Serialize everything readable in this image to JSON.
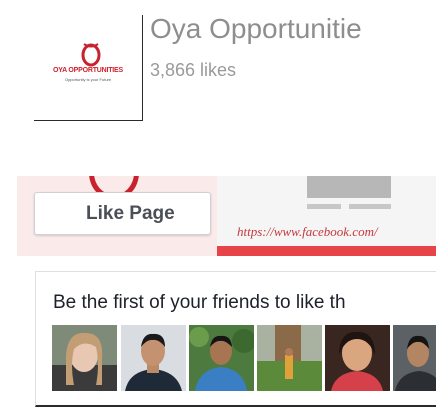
{
  "page": {
    "name": "Oya Opportunitie",
    "likes": "3,866 likes",
    "logo": {
      "title": "OYA OPPORTUNITIES",
      "tagline": "Opportunity is your Future"
    }
  },
  "cover": {
    "url": "https://www.facebook.com/"
  },
  "like_button": {
    "label": "Like Page"
  },
  "friends": {
    "text": "Be the first of your friends to like th",
    "faces": [
      "friend-1",
      "friend-2",
      "friend-3",
      "friend-4",
      "friend-5",
      "friend-6"
    ]
  },
  "colors": {
    "brand_red": "#d0202c",
    "cover_red": "#e64448",
    "text_gray": "#8e8e8e"
  }
}
